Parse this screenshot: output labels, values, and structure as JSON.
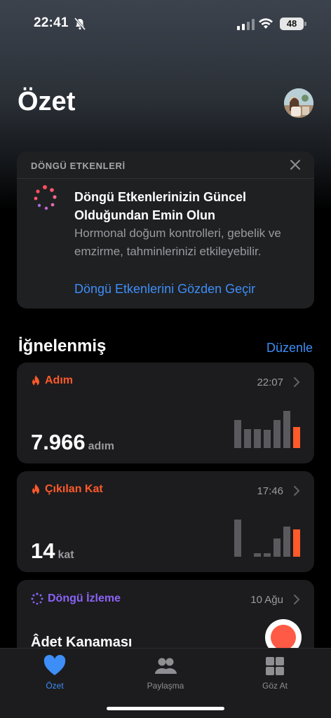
{
  "status_bar": {
    "time": "22:41",
    "battery_percent": "48",
    "icons": [
      "bell-slash-icon",
      "cellular-signal-icon",
      "wifi-icon",
      "battery-icon"
    ]
  },
  "header": {
    "title": "Özet",
    "avatar_icon": "profile-avatar"
  },
  "promo": {
    "header": "DÖNGÜ ETKENLERİ",
    "title": "Döngü Etkenlerinizin Güncel Olduğundan Emin Olun",
    "body": "Hormonal doğum kontrolleri, gebelik ve emzirme, tahminlerinizi etkileyebilir.",
    "link": "Döngü Etkenlerini Gözden Geçir",
    "close_icon": "close-icon"
  },
  "pinned": {
    "title": "İğnelenmiş",
    "edit_label": "Düzenle"
  },
  "metrics": [
    {
      "label": "Adım",
      "time": "22:07",
      "value": "7.966",
      "unit": "adım",
      "bar_levels": [
        0.65,
        0.44,
        0.44,
        0.42,
        0.65,
        0.85,
        0.48
      ]
    },
    {
      "label": "Çıkılan Kat",
      "time": "17:46",
      "value": "14",
      "unit": "kat",
      "bar_levels": [
        0.85,
        0.0,
        0.08,
        0.08,
        0.42,
        0.7,
        0.63
      ]
    }
  ],
  "cycle": {
    "label": "Döngü İzleme",
    "date": "10 Ağu",
    "subtitle": "Âdet Kanaması"
  },
  "tab_bar": {
    "tabs": [
      {
        "label": "Özet",
        "icon": "heart-icon",
        "active": true
      },
      {
        "label": "Paylaşma",
        "icon": "people-icon",
        "active": false
      },
      {
        "label": "Göz At",
        "icon": "grid-icon",
        "active": false
      }
    ]
  },
  "colors": {
    "accent_blue": "#3e8ef7",
    "activity_orange": "#ff5a2a",
    "cycle_purple": "#8a63f5",
    "period_red": "#ff5a45"
  }
}
